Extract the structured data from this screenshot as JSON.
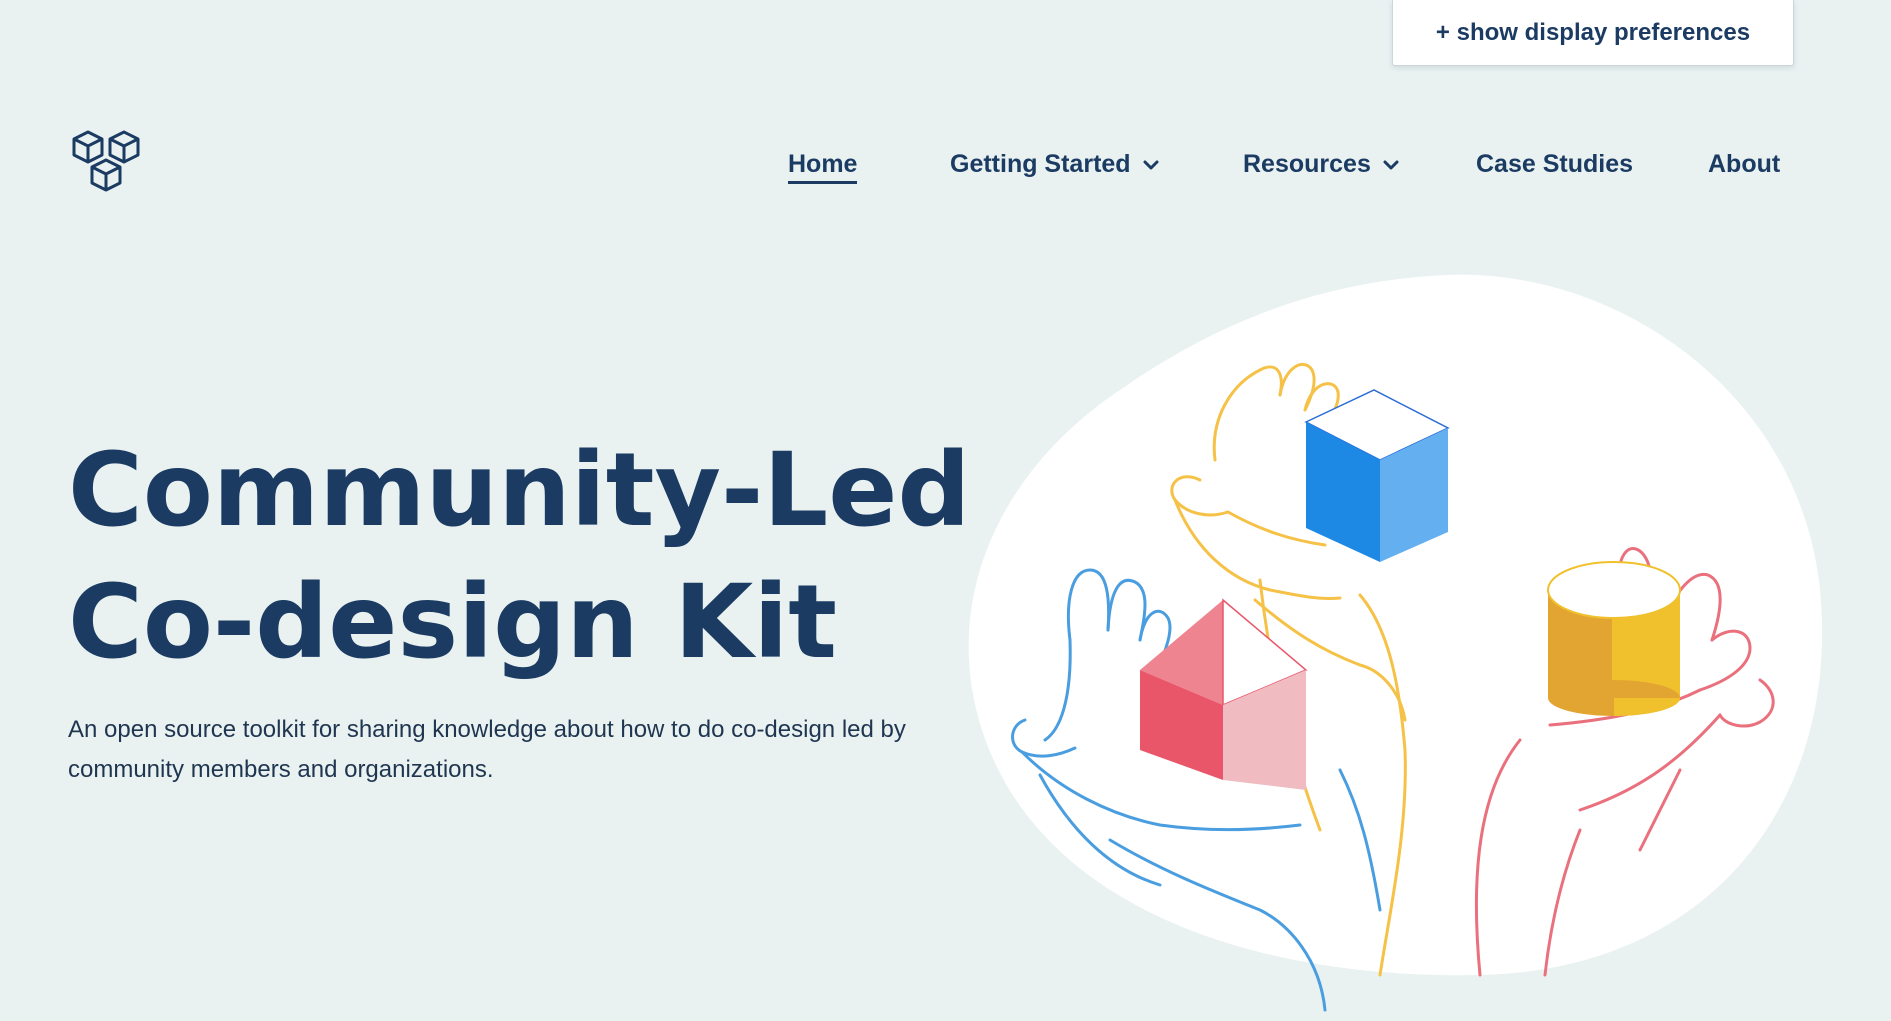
{
  "display_prefs": {
    "label": "+ show display preferences"
  },
  "logo": {
    "icon": "three-cubes-icon"
  },
  "nav": {
    "items": [
      {
        "label": "Home",
        "active": true
      },
      {
        "label": "Getting Started",
        "has_dropdown": true
      },
      {
        "label": "Resources",
        "has_dropdown": true
      },
      {
        "label": "Case Studies"
      },
      {
        "label": "About"
      }
    ]
  },
  "hero": {
    "title_line1": "Community-Led",
    "title_line2": "Co-design Kit",
    "subtitle_line1": "An open source toolkit for sharing knowledge about how to do co-design led by",
    "subtitle_line2": "community members and organizations."
  },
  "illustration": {
    "description_icon": "hands-holding-shapes-icon"
  },
  "colors": {
    "background": "#e9f2f1",
    "text": "#1b3b63",
    "blue": "#1e88e5",
    "red": "#e9566a",
    "yellow": "#f0c12c"
  }
}
